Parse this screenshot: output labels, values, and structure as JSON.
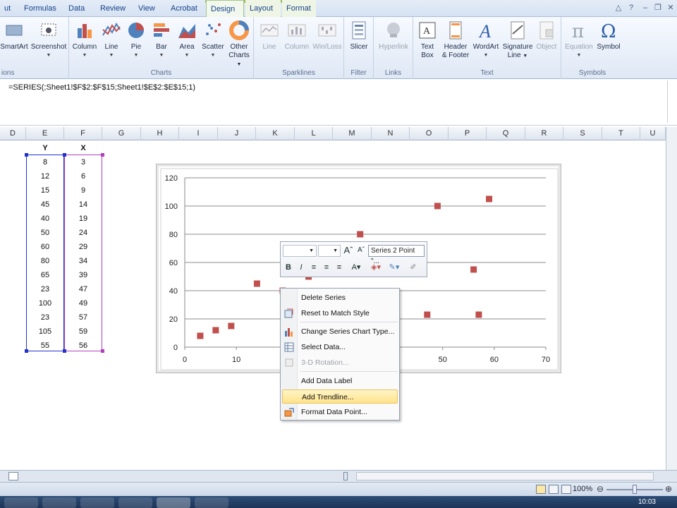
{
  "tabs": [
    "ut",
    "Formulas",
    "Data",
    "Review",
    "View",
    "Acrobat",
    "Design",
    "Layout",
    "Format"
  ],
  "ribbon": {
    "groups": {
      "illustrations": {
        "label": "ions",
        "smartart": "SmartArt",
        "screenshot": "Screenshot"
      },
      "charts": {
        "label": "Charts",
        "column": "Column",
        "line": "Line",
        "pie": "Pie",
        "bar": "Bar",
        "area": "Area",
        "scatter": "Scatter",
        "other": "Other",
        "other2": "Charts"
      },
      "sparklines": {
        "label": "Sparklines",
        "line": "Line",
        "column": "Column",
        "winloss": "Win/Loss"
      },
      "filter": {
        "label": "Filter",
        "slicer": "Slicer"
      },
      "links": {
        "label": "Links",
        "hyperlink": "Hyperlink"
      },
      "text": {
        "label": "Text",
        "textbox": "Text",
        "textbox2": "Box",
        "header": "Header",
        "header2": "& Footer",
        "wordart": "WordArt",
        "signature": "Signature",
        "signature2": "Line",
        "object": "Object"
      },
      "symbols": {
        "label": "Symbols",
        "equation": "Equation",
        "symbol": "Symbol"
      }
    }
  },
  "formula_bar": {
    "text": "=SERIES(;Sheet1!$F$2:$F$15;Sheet1!$E$2:$E$15;1)"
  },
  "columns": [
    "D",
    "E",
    "F",
    "G",
    "H",
    "I",
    "J",
    "K",
    "L",
    "M",
    "N",
    "O",
    "P",
    "Q",
    "R",
    "S",
    "T",
    "U"
  ],
  "table": {
    "header_y": "Y",
    "header_x": "X",
    "y": [
      "8",
      "12",
      "15",
      "45",
      "40",
      "50",
      "60",
      "80",
      "65",
      "23",
      "100",
      "23",
      "105",
      "55"
    ],
    "x": [
      "3",
      "6",
      "9",
      "14",
      "19",
      "24",
      "29",
      "34",
      "39",
      "47",
      "49",
      "57",
      "59",
      "56"
    ]
  },
  "chart_data": {
    "type": "scatter",
    "xlim": [
      0,
      70
    ],
    "ylim": [
      0,
      120
    ],
    "x_ticks": [
      "0",
      "10",
      "20",
      "30",
      "40",
      "50",
      "60",
      "70"
    ],
    "y_ticks": [
      "0",
      "20",
      "40",
      "60",
      "80",
      "100",
      "120"
    ],
    "grid": "horizontal",
    "series": [
      {
        "name": "",
        "color": "#c0504d",
        "points": [
          [
            3,
            8
          ],
          [
            6,
            12
          ],
          [
            9,
            15
          ],
          [
            14,
            45
          ],
          [
            19,
            40
          ],
          [
            24,
            50
          ],
          [
            34,
            80
          ],
          [
            39,
            65
          ],
          [
            47,
            23
          ],
          [
            49,
            100
          ],
          [
            57,
            23
          ],
          [
            59,
            105
          ],
          [
            56,
            55
          ]
        ]
      }
    ]
  },
  "mini_toolbar": {
    "series_label": "Series 2 Point \"..."
  },
  "context_menu": {
    "items": [
      {
        "label": "Delete Series",
        "disabled": false
      },
      {
        "label": "Reset to Match Style",
        "disabled": false
      },
      {
        "label": "Change Series Chart Type...",
        "disabled": false
      },
      {
        "label": "Select Data...",
        "disabled": false
      },
      {
        "label": "3-D Rotation...",
        "disabled": true
      },
      {
        "label": "Add Data Label",
        "disabled": false
      },
      {
        "label": "Add Trendline...",
        "disabled": false
      },
      {
        "label": "Format Data Point...",
        "disabled": false
      }
    ]
  },
  "status": {
    "zoom": "100%"
  },
  "taskbar": {
    "clock": "10:03"
  }
}
